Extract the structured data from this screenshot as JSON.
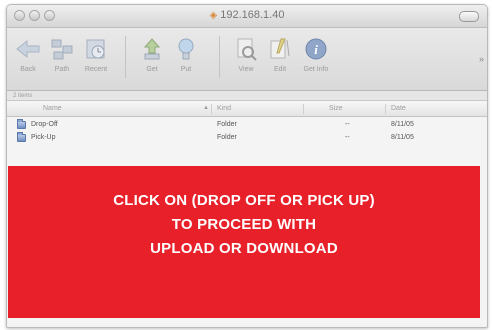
{
  "window": {
    "title": "192.168.1.40"
  },
  "toolbar": {
    "buttons": [
      {
        "label": "Back",
        "icon": "back-arrow-icon"
      },
      {
        "label": "Path",
        "icon": "path-icon"
      },
      {
        "label": "Recent",
        "icon": "recent-icon"
      },
      {
        "label": "Get",
        "icon": "get-icon"
      },
      {
        "label": "Put",
        "icon": "put-icon"
      },
      {
        "label": "View",
        "icon": "view-icon"
      },
      {
        "label": "Edit",
        "icon": "edit-icon"
      },
      {
        "label": "Get Info",
        "icon": "info-icon"
      }
    ],
    "more": "»"
  },
  "status": {
    "text": "2 items"
  },
  "columns": {
    "name": "Name",
    "kind": "Kind",
    "size": "Size",
    "date": "Date"
  },
  "rows": [
    {
      "name": "Drop-Off",
      "kind": "Folder",
      "size": "--",
      "date": "8/11/05"
    },
    {
      "name": "Pick-Up",
      "kind": "Folder",
      "size": "--",
      "date": "8/11/05"
    }
  ],
  "overlay": {
    "line1": "CLICK ON (DROP OFF OR PICK UP)",
    "line2": "TO PROCEED WITH",
    "line3": "UPLOAD OR DOWNLOAD",
    "color": "#e8202a"
  }
}
